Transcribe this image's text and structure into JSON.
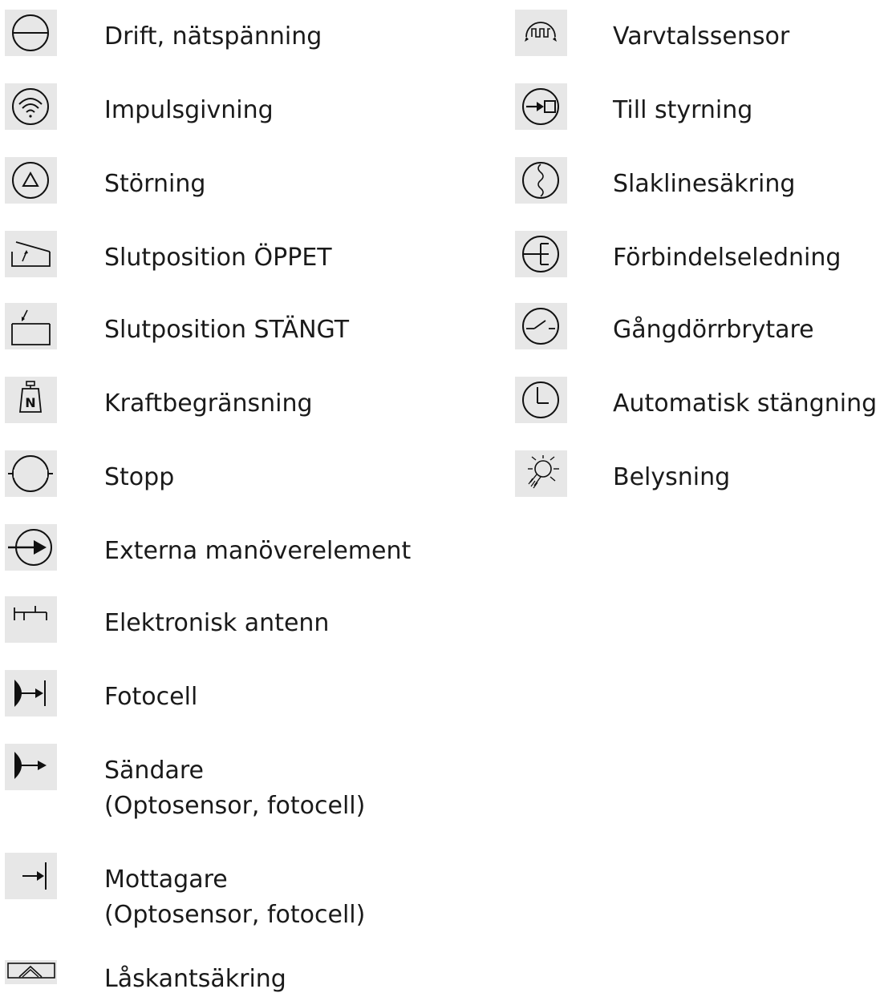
{
  "left_column": [
    {
      "label": "Drift, nätspänning",
      "icon": "mains-power-icon"
    },
    {
      "label": "Impulsgivning",
      "icon": "impulse-icon"
    },
    {
      "label": "Störning",
      "icon": "fault-icon"
    },
    {
      "label": "Slutposition ÖPPET",
      "icon": "end-position-open-icon"
    },
    {
      "label": "Slutposition STÄNGT",
      "icon": "end-position-closed-icon"
    },
    {
      "label": "Kraftbegränsning",
      "icon": "force-limit-icon"
    },
    {
      "label": "Stopp",
      "icon": "stop-icon"
    },
    {
      "label": "Externa manöverelement",
      "icon": "external-control-icon"
    },
    {
      "label": "Elektronisk antenn",
      "icon": "antenna-icon"
    },
    {
      "label": "Fotocell",
      "icon": "photocell-icon"
    },
    {
      "label": "Sändare",
      "label2": "(Optosensor, fotocell)",
      "icon": "transmitter-icon"
    },
    {
      "label": "Mottagare",
      "label2": "(Optosensor, fotocell)",
      "icon": "receiver-icon"
    },
    {
      "label": "Låskantsäkring",
      "icon": "closing-edge-icon"
    }
  ],
  "right_column": [
    {
      "label": "Varvtalssensor",
      "icon": "speed-sensor-icon"
    },
    {
      "label": "Till styrning",
      "icon": "to-control-icon"
    },
    {
      "label": "Slaklinesäkring",
      "icon": "slack-rope-icon"
    },
    {
      "label": "Förbindelseledning",
      "icon": "connection-cable-icon"
    },
    {
      "label": "Gångdörrbrytare",
      "icon": "wicket-door-switch-icon"
    },
    {
      "label": "Automatisk stängning",
      "icon": "auto-close-icon"
    },
    {
      "label": "Belysning",
      "icon": "lighting-icon"
    }
  ]
}
